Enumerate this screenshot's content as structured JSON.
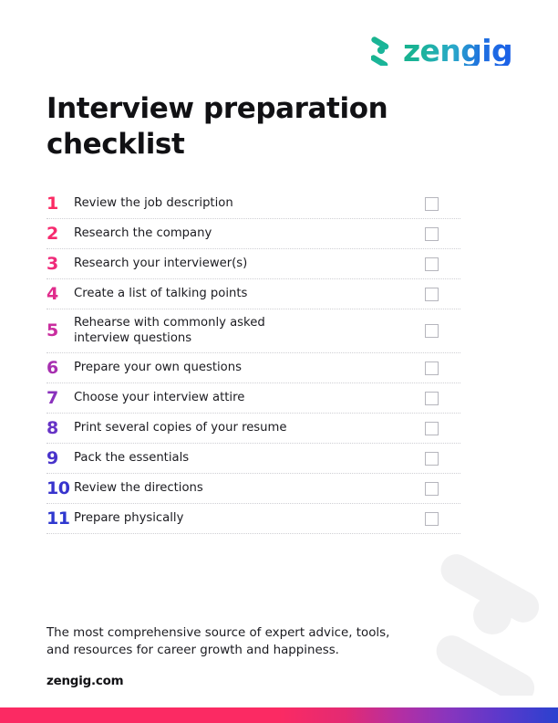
{
  "brand": {
    "logo_mark_name": "zengig-z-mark-icon",
    "wordmark": "zengig",
    "gradient_start": "#17b28c",
    "gradient_end": "#1b5fe8"
  },
  "document": {
    "title": "Interview preparation\nchecklist"
  },
  "checklist": {
    "items": [
      {
        "number": "1",
        "label": "Review the job description",
        "color": "#fb2a63",
        "checked": false
      },
      {
        "number": "2",
        "label": "Research the company",
        "color": "#f62a6e",
        "checked": false
      },
      {
        "number": "3",
        "label": "Research your interviewer(s)",
        "color": "#ef2b7a",
        "checked": false
      },
      {
        "number": "4",
        "label": "Create a list of talking points",
        "color": "#e02c8c",
        "checked": false
      },
      {
        "number": "5",
        "label": "Rehearse with commonly asked\ninterview questions",
        "color": "#c92d9f",
        "checked": false
      },
      {
        "number": "6",
        "label": "Prepare your own questions",
        "color": "#a72fb0",
        "checked": false
      },
      {
        "number": "7",
        "label": "Choose your interview attire",
        "color": "#8a31bd",
        "checked": false
      },
      {
        "number": "8",
        "label": "Print several copies of your resume",
        "color": "#6633c6",
        "checked": false
      },
      {
        "number": "9",
        "label": "Pack the essentials",
        "color": "#4833cb",
        "checked": false
      },
      {
        "number": "10",
        "label": "Review the directions",
        "color": "#3733cd",
        "checked": false
      },
      {
        "number": "11",
        "label": "Prepare physically",
        "color": "#2f38cf",
        "checked": false
      }
    ]
  },
  "footer": {
    "tagline": "The most comprehensive source of expert advice, tools,\nand resources for career growth and happiness.",
    "site": "zengig.com"
  },
  "decoration": {
    "watermark_name": "zengig-z-watermark",
    "watermark_color": "#f1f1f2",
    "bottom_bar_start": "#fb2a63",
    "bottom_bar_end": "#2a41cf"
  }
}
